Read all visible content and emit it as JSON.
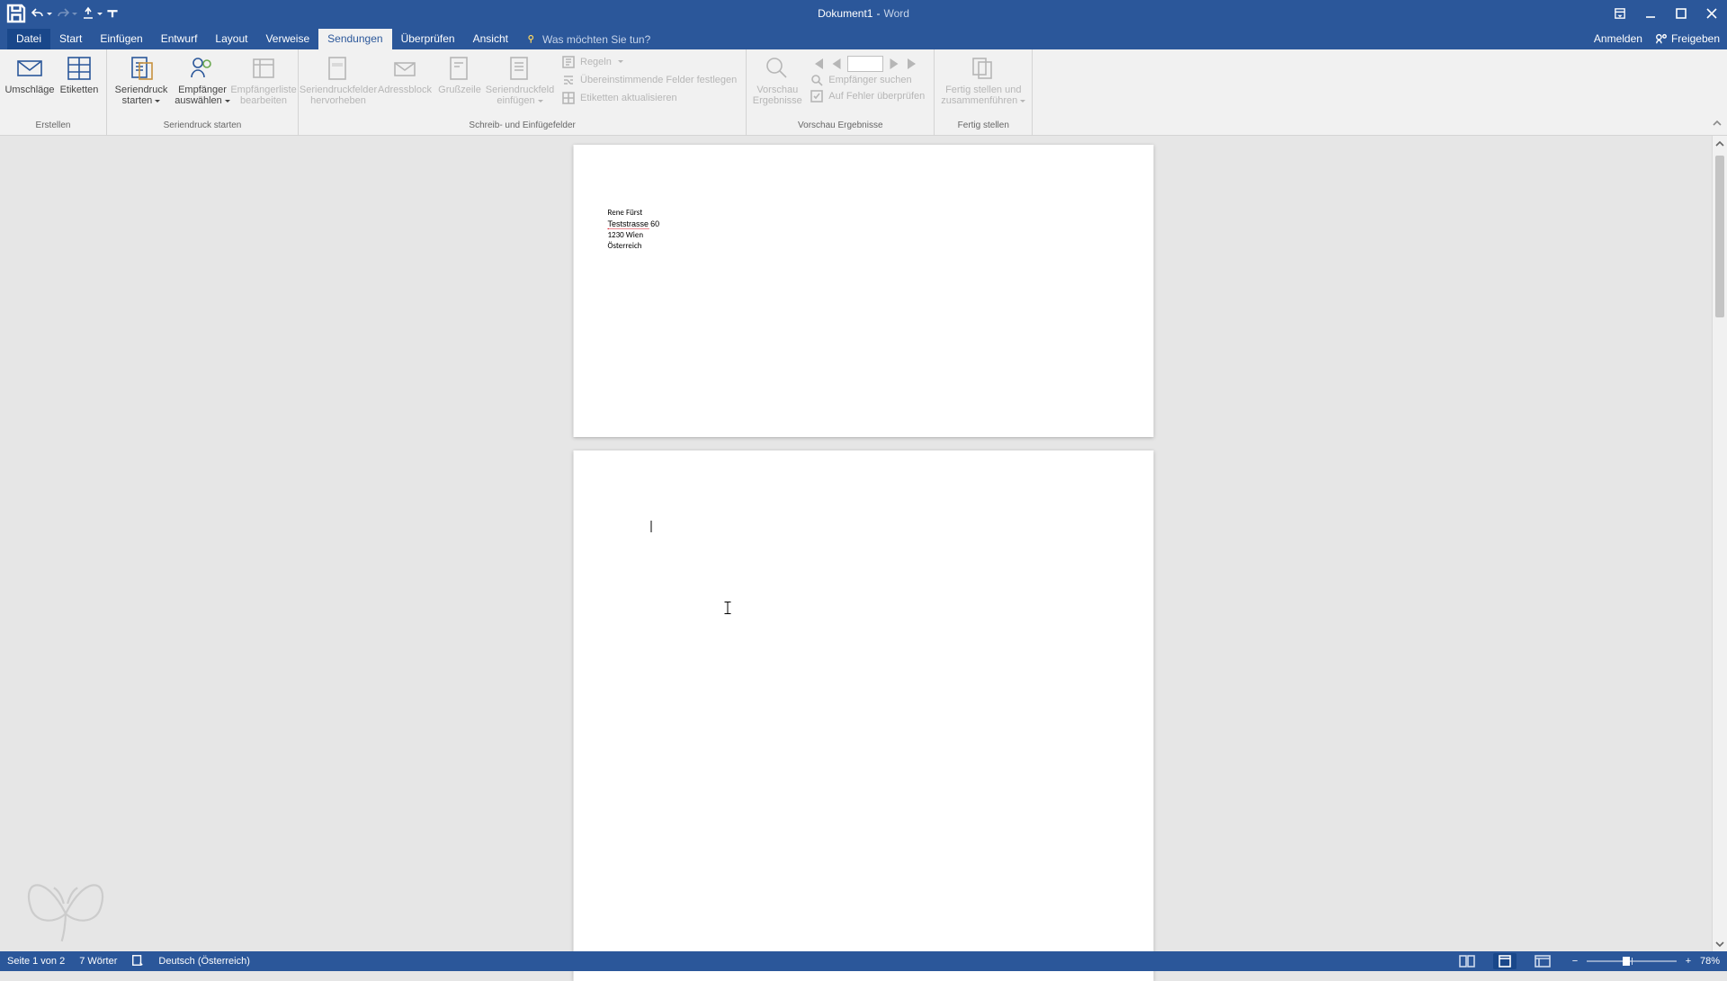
{
  "colors": {
    "accent": "#2b579a"
  },
  "title": {
    "doc": "Dokument1",
    "app": "Word"
  },
  "qat": {
    "save": "save",
    "undo": "undo",
    "redo": "redo",
    "touch": "touch-mode"
  },
  "account": {
    "signin": "Anmelden",
    "share": "Freigeben"
  },
  "tabs": {
    "file": "Datei",
    "items": [
      "Start",
      "Einfügen",
      "Entwurf",
      "Layout",
      "Verweise",
      "Sendungen",
      "Überprüfen",
      "Ansicht"
    ],
    "active_index": 5,
    "tellme_placeholder": "Was möchten Sie tun?"
  },
  "ribbon": {
    "groups": {
      "erstellen": {
        "label": "Erstellen",
        "umschlaege": "Umschläge",
        "etiketten": "Etiketten"
      },
      "starten": {
        "label": "Seriendruck starten",
        "seriendruck_starten": "Seriendruck starten",
        "empf_auswaehlen": "Empfänger auswählen",
        "empf_bearbeiten": "Empfängerliste bearbeiten"
      },
      "felder": {
        "label": "Schreib- und Einfügefelder",
        "hervorheben": "Seriendruckfelder hervorheben",
        "adressblock": "Adressblock",
        "grusszeile": "Grußzeile",
        "feld_einfuegen": "Seriendruckfeld einfügen",
        "regeln": "Regeln",
        "felder_festlegen": "Übereinstimmende Felder festlegen",
        "etiketten_aktualisieren": "Etiketten aktualisieren"
      },
      "vorschau": {
        "label": "Vorschau Ergebnisse",
        "vorschau_ergebnisse": "Vorschau Ergebnisse",
        "empf_suchen": "Empfänger suchen",
        "fehler_pruefen": "Auf Fehler überprüfen"
      },
      "fertig": {
        "label": "Fertig stellen",
        "fertig": "Fertig stellen und zusammenführen"
      }
    }
  },
  "document": {
    "addr_name": "Rene Fürst",
    "addr_street_name": "Teststrasse",
    "addr_street_no": "60",
    "addr_city": "1230 Wien",
    "addr_country": "Österreich"
  },
  "status": {
    "page": "Seite 1 von 2",
    "words": "7 Wörter",
    "language": "Deutsch (Österreich)",
    "zoom": "78%"
  }
}
